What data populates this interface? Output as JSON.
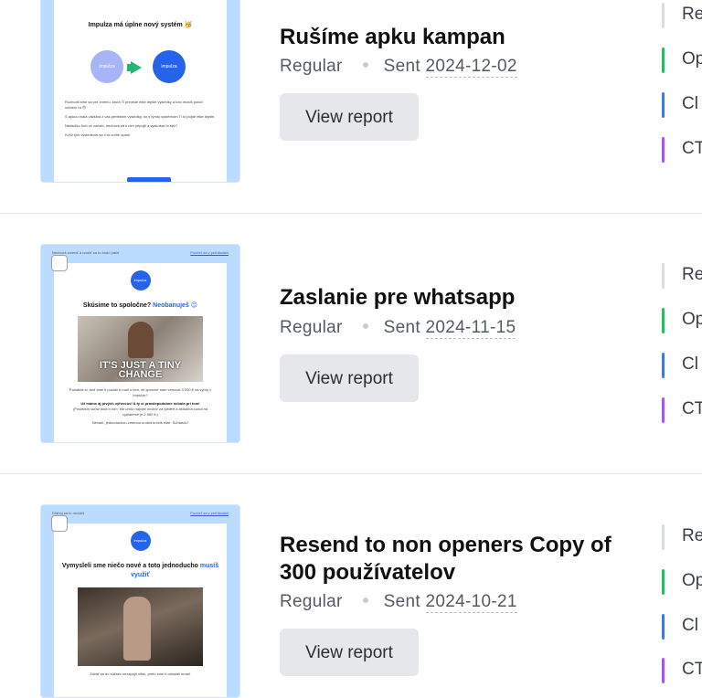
{
  "campaigns": [
    {
      "title": "Rušíme apku kampan",
      "type": "Regular",
      "sent_label": "Sent",
      "sent_date": "2024-12-02",
      "view_report": "View report",
      "preview": {
        "heading": "Impulza má úplne nový systém 🥳",
        "logo_text": "impulza",
        "body": [
          "Rozhodli sme sa pre zmenu, ktorá Ti prinesie ešte lepšie výsledky a toto musíš počuť: odmeni ťa 😍",
          "S apkou mala väčšina z vás perfektné výsledky, no s týmto systémom Ti to pôjde ešte lepšie.",
          "Niektoľko ľudí už začalo, nechceš sa k nim pripojiť a vyskúšať to tiež?",
          "Kvôli tým výsledkom sa ti to určite oplatí."
        ]
      },
      "stats": [
        "Re",
        "Op",
        "Cl",
        "CT"
      ]
    },
    {
      "title": "Zaslanie pre whatsapp",
      "type": "Regular",
      "sent_label": "Sent",
      "sent_date": "2024-11-15",
      "view_report": "View report",
      "preview": {
        "top_left": "Nechceš zmeniť a urobiť sa to budú páčiť",
        "top_right": "Pozrieť sa v prehliadači",
        "logo_text": "impulza",
        "heading": "Skúsime to spoločne?",
        "heading_accent": "Neobanuješ 😉",
        "image_caption": "IT'S JUST A TINY CHANGE",
        "body": [
          "Pamätáš si, keď sme ti poslali e-mail o tom, že sponzor nám venoval 3 000 € na výhry v Impulze?",
          "Už máme aj prvých výhercov! A ty si pravdepodobne nebola pri tom!",
          "(Posledná súťaž bola o tom, kto urobí najviac krokov za týždeň a aktuálna suma na vyplatenie je 2 980 €.)",
          "Nevadí, jednoduchou zmenou urobíš krôčik ešte. Súhlasíš?"
        ]
      },
      "stats": [
        "Re",
        "Op",
        "Cl",
        "CT"
      ]
    },
    {
      "title": "Resend to non openers Copy of 300 používatelov",
      "type": "Regular",
      "sent_label": "Sent",
      "sent_date": "2024-10-21",
      "view_report": "View report",
      "preview": {
        "top_left": "Sťahuj sa to nevidíš",
        "top_right": "Pozrieť sa v prehliadači",
        "logo_text": "impulza",
        "heading": "Vymysleli sme niečo nové a toto jednoducho",
        "heading_accent": "musíš využiť",
        "body": [
          "Začať sa do súťaže nezapojil nikto, preto sme ti odoslali email."
        ]
      },
      "stats": [
        "Re",
        "Op",
        "Cl",
        "CT"
      ]
    }
  ],
  "colors": {
    "stat_received": "#d9dce0",
    "stat_opened": "#1fbf6a",
    "stat_clicked": "#3b7ddd",
    "stat_ctr": "#a855f7",
    "preview_bg": "#bcdcff",
    "brand_blue": "#2563eb"
  }
}
